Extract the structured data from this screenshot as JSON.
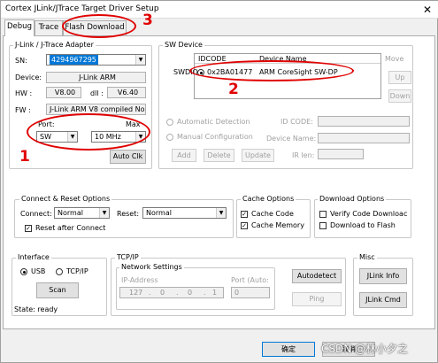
{
  "window": {
    "title": "Cortex JLink/JTrace Target Driver Setup",
    "close_glyph": "✕"
  },
  "tabs": [
    {
      "label": "Debug"
    },
    {
      "label": "Trace"
    },
    {
      "label": "Flash Download"
    }
  ],
  "jlink": {
    "group_label": "J-Link / J-Trace Adapter",
    "sn_label": "SN:",
    "sn_value": "4294967295",
    "device_label": "Device:",
    "device_value": "J-Link ARM",
    "hw_label": "HW :",
    "hw_value": "V8.00",
    "dll_label": "dll :",
    "dll_value": "V6.40",
    "fw_label": "FW :",
    "fw_value": "J-Link ARM V8 compiled No",
    "port_label": "Port:",
    "port_value": "SW",
    "max_label": "Max",
    "max_value": "10 MHz",
    "autoclk_label": "Auto Clk"
  },
  "swdevice": {
    "group_label": "SW Device",
    "col_idcode": "IDCODE",
    "col_devname": "Device Name",
    "row_prefix": "SWDIO",
    "row_idcode": "0x2BA01477",
    "row_name": "ARM CoreSight SW-DP",
    "move_label": "Move",
    "up_label": "Up",
    "down_label": "Down",
    "auto_detect": "Automatic Detection",
    "manual_config": "Manual Configuration",
    "idcode_label": "ID CODE:",
    "devname_label": "Device Name:",
    "irlen_label": "IR len:",
    "add_label": "Add",
    "delete_label": "Delete",
    "update_label": "Update"
  },
  "connect": {
    "group_label": "Connect & Reset Options",
    "connect_label": "Connect:",
    "connect_value": "Normal",
    "reset_label": "Reset:",
    "reset_value": "Normal",
    "reset_after_label": "Reset after Connect"
  },
  "cache": {
    "group_label": "Cache Options",
    "cache_code": "Cache Code",
    "cache_memory": "Cache Memory"
  },
  "download": {
    "group_label": "Download Options",
    "verify": "Verify Code Downloac",
    "dl_flash": "Download to Flash"
  },
  "interface": {
    "group_label": "Interface",
    "usb": "USB",
    "tcpip": "TCP/IP",
    "scan": "Scan",
    "state": "State: ready"
  },
  "tcp": {
    "group_label": "TCP/IP",
    "netsettings": "Network Settings",
    "ip_label": "IP-Address",
    "ip": [
      "127",
      "0",
      "0",
      "1"
    ],
    "port_label": "Port (Auto:",
    "port_value": "0",
    "autodetect": "Autodetect",
    "ping": "Ping"
  },
  "misc": {
    "group_label": "Misc",
    "jlink_info": "JLink Info",
    "jlink_cmd": "JLink Cmd"
  },
  "footer": {
    "ok": "确定",
    "cancel": "取消",
    "watermark": "CSDN @林小夕之"
  },
  "annotations": {
    "mark_3": "3",
    "mark_2": "2",
    "mark_1": "1",
    "color": "#e00000"
  }
}
